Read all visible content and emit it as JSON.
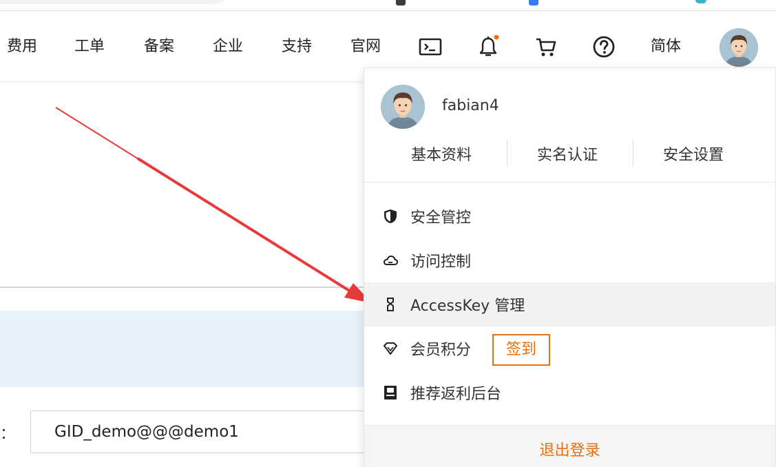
{
  "nav": {
    "items": [
      "费用",
      "工单",
      "备案",
      "企业",
      "支持",
      "官网"
    ],
    "icons": [
      "terminal-icon",
      "bell-icon",
      "cart-icon",
      "help-icon"
    ],
    "language": "简体",
    "notification_dot_color": "#ff6a00"
  },
  "form": {
    "label_fragment": "：",
    "input_value": "GID_demo@@@demo1"
  },
  "dropdown": {
    "username": "fabian4",
    "profile_links": [
      "基本资料",
      "实名认证",
      "安全设置"
    ],
    "menu": [
      {
        "label": "安全管控",
        "icon": "shield-icon"
      },
      {
        "label": "访问控制",
        "icon": "cloud-icon"
      },
      {
        "label": "AccessKey 管理",
        "icon": "key-icon"
      },
      {
        "label": "会员积分",
        "icon": "diamond-icon"
      },
      {
        "label": "推荐返利后台",
        "icon": "book-icon"
      }
    ],
    "checkin_label": "签到",
    "logout_label": "退出登录",
    "accent_color": "#e8700f"
  }
}
